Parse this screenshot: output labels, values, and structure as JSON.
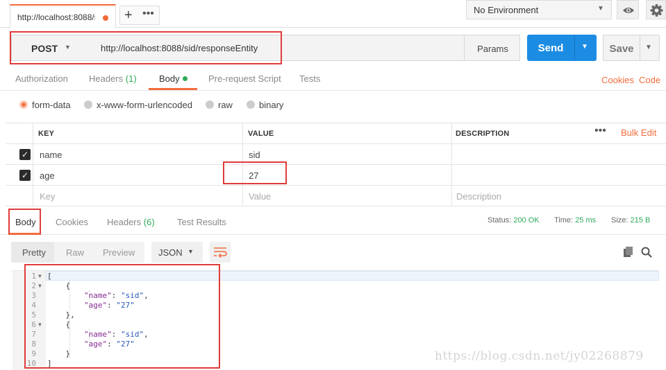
{
  "tab": {
    "label": "http://localhost:8088/s",
    "unsaved": true
  },
  "tab_actions": {
    "more": "•••"
  },
  "environment": {
    "label": "No Environment"
  },
  "request": {
    "method": "POST",
    "url": "http://localhost:8088/sid/responseEntity",
    "params_label": "Params",
    "send_label": "Send",
    "save_label": "Save"
  },
  "request_tabs": [
    {
      "label": "Authorization"
    },
    {
      "label": "Headers",
      "count": "(1)"
    },
    {
      "label": "Body"
    },
    {
      "label": "Pre-request Script"
    },
    {
      "label": "Tests"
    }
  ],
  "request_links": {
    "cookies": "Cookies",
    "code": "Code"
  },
  "body_types": [
    {
      "label": "form-data",
      "selected": true
    },
    {
      "label": "x-www-form-urlencoded"
    },
    {
      "label": "raw"
    },
    {
      "label": "binary"
    }
  ],
  "kv_table": {
    "headers": {
      "key": "KEY",
      "value": "VALUE",
      "description": "DESCRIPTION"
    },
    "more": "•••",
    "bulk_edit": "Bulk Edit",
    "rows": [
      {
        "checked": true,
        "key": "name",
        "value": "sid",
        "description": ""
      },
      {
        "checked": true,
        "key": "age",
        "value": "27",
        "description": ""
      }
    ],
    "placeholder": {
      "key": "Key",
      "value": "Value",
      "description": "Description"
    }
  },
  "response_tabs": [
    {
      "label": "Body"
    },
    {
      "label": "Cookies"
    },
    {
      "label": "Headers",
      "count": "(6)"
    },
    {
      "label": "Test Results"
    }
  ],
  "response_status": {
    "status_label": "Status:",
    "status": "200 OK",
    "time_label": "Time:",
    "time": "25 ms",
    "size_label": "Size:",
    "size": "215 B"
  },
  "response_toolbar": {
    "formats": [
      "Pretty",
      "Raw",
      "Preview"
    ],
    "language": "JSON"
  },
  "response_body": {
    "lines": [
      {
        "n": "1",
        "fold": true,
        "text": "["
      },
      {
        "n": "2",
        "fold": true,
        "text": "    {"
      },
      {
        "n": "3",
        "text": "        \"name\": \"sid\","
      },
      {
        "n": "4",
        "text": "        \"age\": \"27\""
      },
      {
        "n": "5",
        "text": "    },"
      },
      {
        "n": "6",
        "fold": true,
        "text": "    {"
      },
      {
        "n": "7",
        "text": "        \"name\": \"sid\","
      },
      {
        "n": "8",
        "text": "        \"age\": \"27\""
      },
      {
        "n": "9",
        "text": "    }"
      },
      {
        "n": "10",
        "text": "]"
      }
    ]
  },
  "watermark": "https://blog.csdn.net/jy02268879",
  "colors": {
    "accent": "#f26b3a",
    "send": "#1c8ce3",
    "green": "#2eaa5b",
    "annotation": "#e03a3a"
  }
}
